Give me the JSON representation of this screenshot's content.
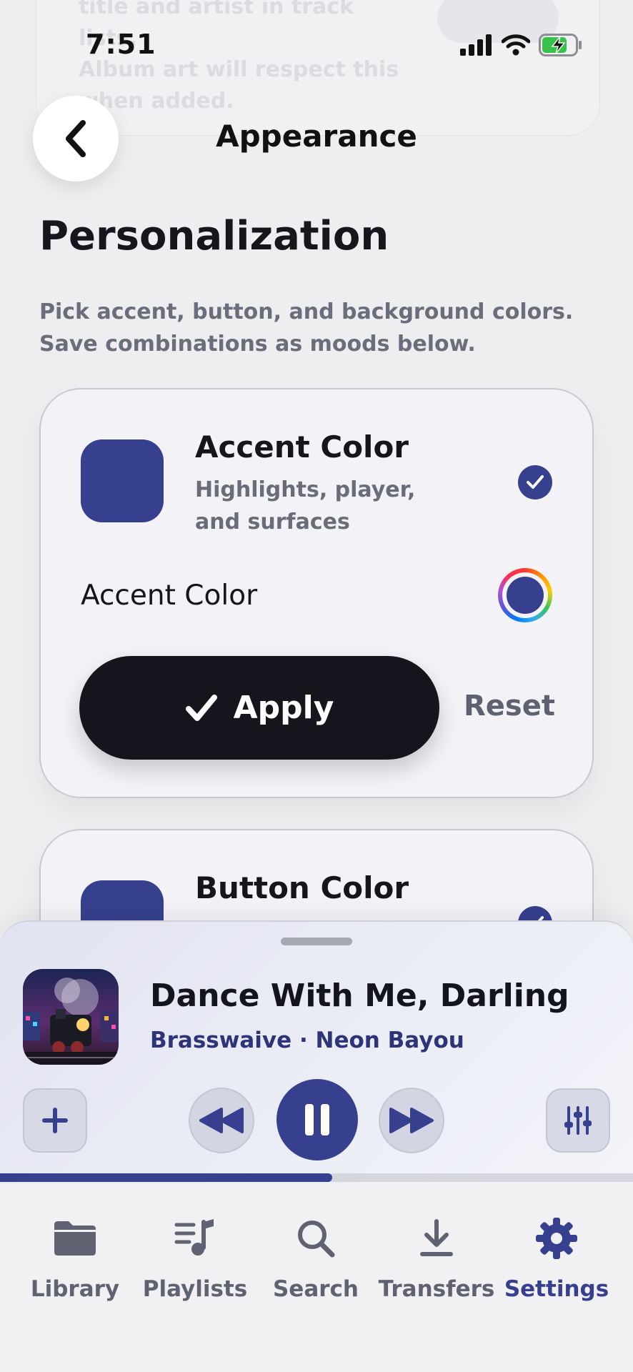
{
  "colors": {
    "accent": "#36408f",
    "background": "#eeeef1",
    "apply_button": "#14151d"
  },
  "status_bar": {
    "time": "7:51",
    "icons": [
      "signal-icon",
      "wifi-icon",
      "battery-charging-icon"
    ]
  },
  "background_card": {
    "text": "title and artist in track lists.\nAlbum art will respect this\nwhen added."
  },
  "header": {
    "title": "Appearance",
    "back_icon": "chevron-left-icon"
  },
  "section": {
    "title": "Personalization",
    "description": "Pick accent, button, and background colors. Save combinations as moods below."
  },
  "cards": [
    {
      "title": "Accent Color",
      "subtitle": "Highlights, player,\nand surfaces",
      "swatch_color": "#36408f",
      "selected": true,
      "row_label": "Accent Color",
      "apply_label": "Apply",
      "reset_label": "Reset"
    },
    {
      "title": "Button Color",
      "swatch_color": "#36408f",
      "selected": true
    }
  ],
  "player": {
    "title": "Dance With Me, Darling",
    "meta": "Brasswaive · Neon Bayou",
    "progress": 0.525,
    "controls": [
      "plus-icon",
      "rewind-icon",
      "pause-icon",
      "fast-forward-icon",
      "equalizer-icon"
    ]
  },
  "tabs": [
    {
      "label": "Library",
      "icon": "folder-icon",
      "active": false
    },
    {
      "label": "Playlists",
      "icon": "music-list-icon",
      "active": false
    },
    {
      "label": "Search",
      "icon": "search-icon",
      "active": false
    },
    {
      "label": "Transfers",
      "icon": "download-icon",
      "active": false
    },
    {
      "label": "Settings",
      "icon": "gear-icon",
      "active": true
    }
  ]
}
